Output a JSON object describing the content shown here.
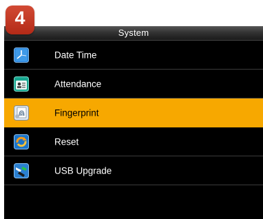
{
  "step_badge": "4",
  "header": {
    "title": "System"
  },
  "menu": {
    "items": [
      {
        "label": "Date Time",
        "icon": "clock-icon",
        "selected": false
      },
      {
        "label": "Attendance",
        "icon": "attendance-icon",
        "selected": false
      },
      {
        "label": "Fingerprint",
        "icon": "fingerprint-icon",
        "selected": true
      },
      {
        "label": "Reset",
        "icon": "reset-icon",
        "selected": false
      },
      {
        "label": "USB Upgrade",
        "icon": "usb-upgrade-icon",
        "selected": false
      }
    ]
  },
  "colors": {
    "selection": "#f7a800",
    "badge": "#c0392b",
    "background": "#000000"
  }
}
